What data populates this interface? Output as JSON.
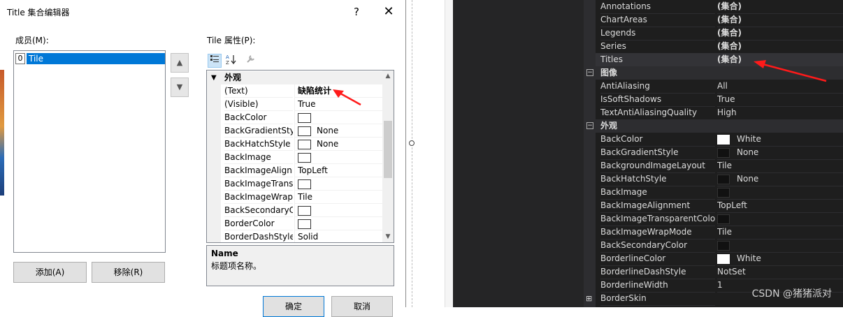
{
  "dialog": {
    "title": "Title 集合编辑器",
    "help": "?",
    "close": "✕",
    "members_label": "成员(M):",
    "members": [
      {
        "index": "0",
        "name": "Tile"
      }
    ],
    "up": "▲",
    "down": "▼",
    "add": "添加(A)",
    "remove": "移除(R)",
    "props_label": "Tile 属性(P):",
    "category": "外观",
    "grid": [
      {
        "name": "(Text)",
        "value": "缺陷统计",
        "bold": true,
        "swatch": false
      },
      {
        "name": "(Visible)",
        "value": "True",
        "swatch": false
      },
      {
        "name": "BackColor",
        "value": "",
        "swatch": true
      },
      {
        "name": "BackGradientStyl",
        "value": "None",
        "swatch": true
      },
      {
        "name": "BackHatchStyle",
        "value": "None",
        "swatch": true
      },
      {
        "name": "BackImage",
        "value": "",
        "swatch": true
      },
      {
        "name": "BackImageAlignr",
        "value": "TopLeft",
        "swatch": false
      },
      {
        "name": "BackImageTransp",
        "value": "",
        "swatch": true
      },
      {
        "name": "BackImageWrapl",
        "value": "Tile",
        "swatch": false
      },
      {
        "name": "BackSecondaryCo",
        "value": "",
        "swatch": true
      },
      {
        "name": "BorderColor",
        "value": "",
        "swatch": true
      },
      {
        "name": "BorderDashStyle",
        "value": "Solid",
        "swatch": false
      }
    ],
    "desc_title": "Name",
    "desc_text": "标题项名称。",
    "ok": "确定",
    "cancel": "取消"
  },
  "panel": {
    "rows": [
      {
        "kind": "prop",
        "name": "Annotations",
        "value": "(集合)",
        "bold": true
      },
      {
        "kind": "prop",
        "name": "ChartAreas",
        "value": "(集合)",
        "bold": true
      },
      {
        "kind": "prop",
        "name": "Legends",
        "value": "(集合)",
        "bold": true
      },
      {
        "kind": "prop",
        "name": "Series",
        "value": "(集合)",
        "bold": true
      },
      {
        "kind": "prop",
        "name": "Titles",
        "value": "(集合)",
        "bold": true,
        "selected": true
      },
      {
        "kind": "cat",
        "name": "图像",
        "expander": "⊟"
      },
      {
        "kind": "prop",
        "name": "AntiAliasing",
        "value": "All"
      },
      {
        "kind": "prop",
        "name": "IsSoftShadows",
        "value": "True"
      },
      {
        "kind": "prop",
        "name": "TextAntiAliasingQuality",
        "value": "High"
      },
      {
        "kind": "cat",
        "name": "外观",
        "expander": "⊟"
      },
      {
        "kind": "prop",
        "name": "BackColor",
        "value": "White",
        "swatch": "white"
      },
      {
        "kind": "prop",
        "name": "BackGradientStyle",
        "value": "None",
        "swatch": "black"
      },
      {
        "kind": "prop",
        "name": "BackgroundImageLayout",
        "value": "Tile"
      },
      {
        "kind": "prop",
        "name": "BackHatchStyle",
        "value": "None",
        "swatch": "black"
      },
      {
        "kind": "prop",
        "name": "BackImage",
        "value": "",
        "swatch": "black"
      },
      {
        "kind": "prop",
        "name": "BackImageAlignment",
        "value": "TopLeft"
      },
      {
        "kind": "prop",
        "name": "BackImageTransparentColo",
        "value": "",
        "swatch": "black"
      },
      {
        "kind": "prop",
        "name": "BackImageWrapMode",
        "value": "Tile"
      },
      {
        "kind": "prop",
        "name": "BackSecondaryColor",
        "value": "",
        "swatch": "black"
      },
      {
        "kind": "prop",
        "name": "BorderlineColor",
        "value": "White",
        "swatch": "white"
      },
      {
        "kind": "prop",
        "name": "BorderlineDashStyle",
        "value": "NotSet"
      },
      {
        "kind": "prop",
        "name": "BorderlineWidth",
        "value": "1"
      },
      {
        "kind": "prop",
        "name": "BorderSkin",
        "value": "",
        "expander": "⊞"
      }
    ],
    "watermark": "CSDN @猪猪派对"
  },
  "colors": {
    "annotation_arrow": "#ff1a1a",
    "selection": "#0078d7",
    "dark_bg": "#1e1e1e"
  }
}
